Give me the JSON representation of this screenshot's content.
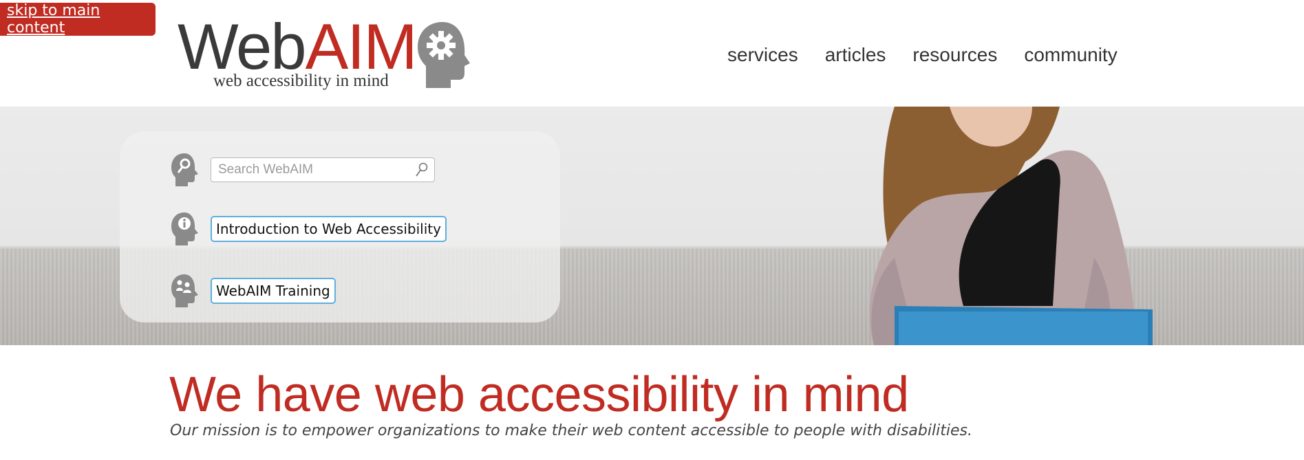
{
  "skip_link": "skip to main content",
  "logo": {
    "word_web": "Web",
    "word_aim": "AIM",
    "tagline": "web accessibility in mind",
    "icon": "gear-head-icon"
  },
  "nav": [
    {
      "label": "services"
    },
    {
      "label": "articles"
    },
    {
      "label": "resources"
    },
    {
      "label": "community"
    }
  ],
  "hero": {
    "search": {
      "placeholder": "Search WebAIM",
      "icon": "magnifier-icon"
    },
    "links": [
      {
        "label": "Introduction to Web Accessibility",
        "icon": "info-head-icon"
      },
      {
        "label": "WebAIM Training",
        "icon": "people-head-icon"
      }
    ]
  },
  "main": {
    "headline": "We have web accessibility in mind",
    "mission": "Our mission is to empower organizations to make their web content accessible to people with disabilities."
  },
  "colors": {
    "brand_red": "#c02b22",
    "focus_blue": "#5eaedd",
    "text_gray": "#333333"
  }
}
